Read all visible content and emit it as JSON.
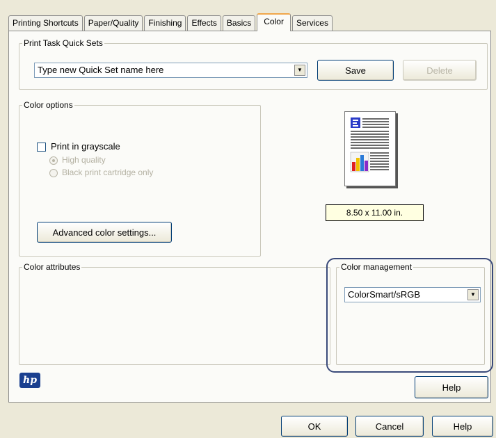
{
  "tabs": [
    {
      "label": "Printing Shortcuts"
    },
    {
      "label": "Paper/Quality"
    },
    {
      "label": "Finishing"
    },
    {
      "label": "Effects"
    },
    {
      "label": "Basics"
    },
    {
      "label": "Color",
      "active": true
    },
    {
      "label": "Services"
    }
  ],
  "quick_sets": {
    "legend": "Print Task Quick Sets",
    "combo_value": "Type new Quick Set name here",
    "save_label": "Save",
    "delete_label": "Delete"
  },
  "color_options": {
    "legend": "Color options",
    "grayscale_label": "Print in grayscale",
    "grayscale_checked": false,
    "radio_high": "High quality",
    "radio_black": "Black print cartridge only",
    "advanced_label": "Advanced color settings..."
  },
  "preview": {
    "page_size": "8.50 x 11.00 in."
  },
  "color_attributes": {
    "legend": "Color attributes"
  },
  "color_management": {
    "legend": "Color management",
    "value": "ColorSmart/sRGB"
  },
  "brand": {
    "logo_text": "hp"
  },
  "buttons": {
    "help_panel": "Help",
    "ok": "OK",
    "cancel": "Cancel",
    "help": "Help"
  },
  "colors": {
    "accent_tab": "#f0a64a",
    "dialog_bg": "#ece9d8",
    "panel_bg": "#fbfbf8",
    "hp_logo": "#1a3f8f"
  }
}
